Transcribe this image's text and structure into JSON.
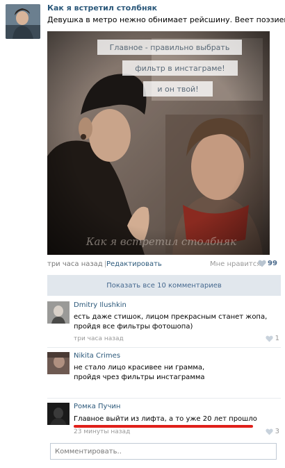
{
  "post": {
    "author": "Как я встретил столбняк",
    "text": "Девушка в метро нежно обнимает рейсшину. Веет поэзией.",
    "image_caption_lines": [
      "Главное - правильно выбрать",
      "фильтр в инстаграме!",
      "и он твой!"
    ],
    "image_watermark": "Как я встретил столбняк",
    "time": "три часа назад",
    "separator": "|",
    "edit_label": "Редактировать",
    "likes_label": "Мне нравится",
    "likes_count": "99"
  },
  "show_all_comments": "Показать все 10 комментариев",
  "comments": [
    {
      "author": "Dmitry Ilushkin",
      "lines": [
        "есть даже стишок, лицом прекрасным станет жопа,",
        "пройдя все фильтры фотошопа)"
      ],
      "time": "три часа назад",
      "likes": "1"
    },
    {
      "author": "Nikita Crimes",
      "lines": [
        "не стало лицо красивее ни грамма,",
        "пройдя чрез фильтры инстаграмма"
      ],
      "time": "",
      "likes": ""
    },
    {
      "author": "Ромка Пучин",
      "lines": [
        "Главное выйти из лифта, а то уже 20 лет прошло"
      ],
      "time": "23 минуты назад",
      "likes": "3"
    }
  ],
  "comment_input": {
    "placeholder": "Комментировать.."
  },
  "colors": {
    "link": "#2B587A",
    "show_all_bg": "#E1E7ED",
    "underline": "#e0201a"
  }
}
